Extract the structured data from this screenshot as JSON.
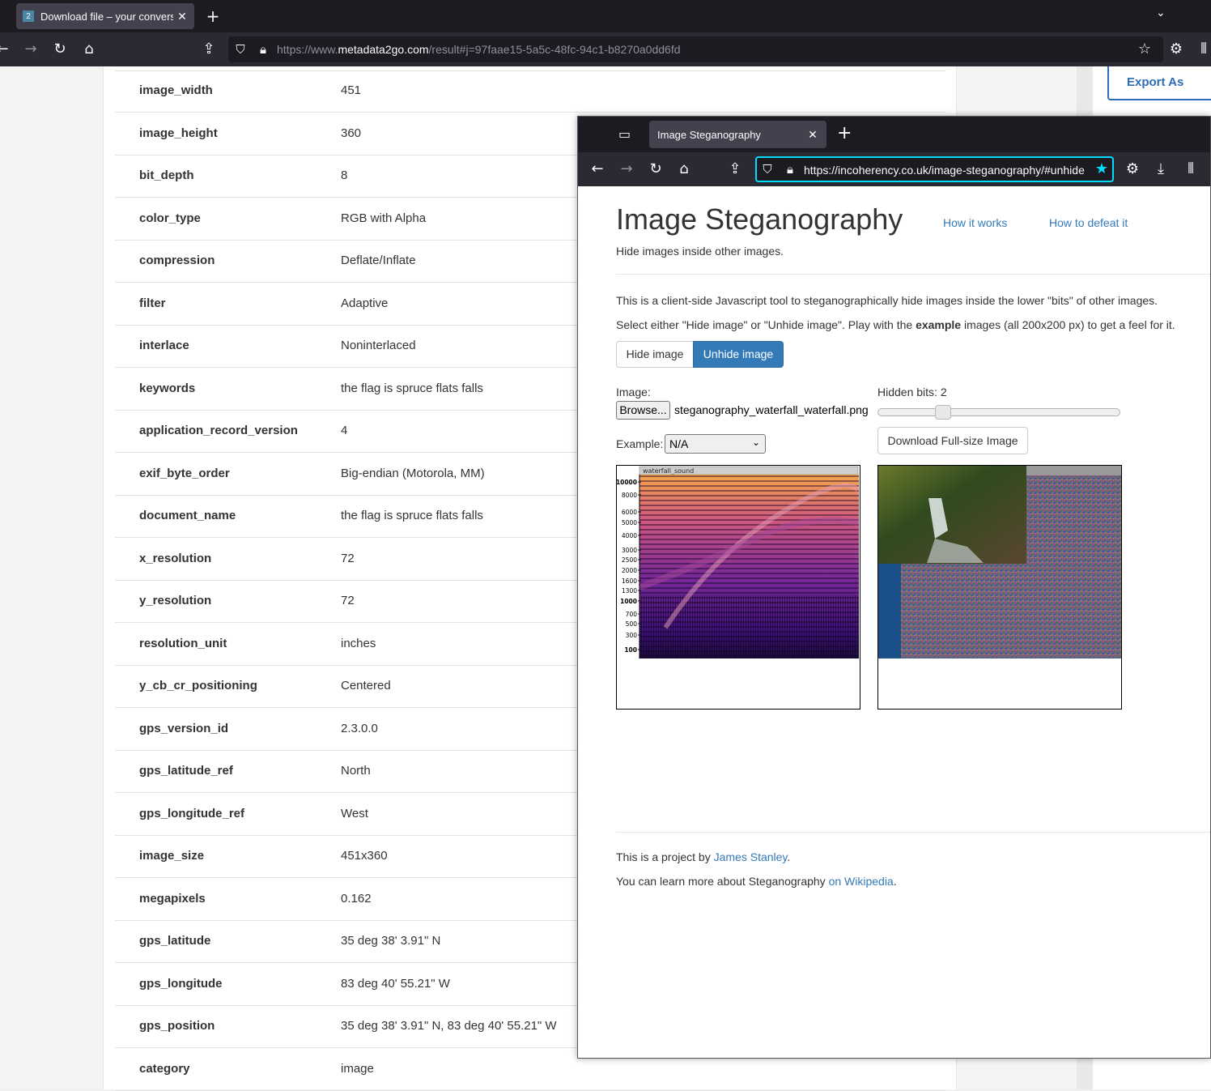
{
  "back_browser": {
    "tab_title": "Download file – your conversion",
    "tab_favicon_text": "2",
    "url_prefix": "https://www.",
    "url_domain": "metadata2go.com",
    "url_rest": "/result#j=97faae15-5a5c-48fc-94c1-b8270a0dd6fd"
  },
  "back_page": {
    "export_label": "Export As",
    "rows": [
      {
        "key": "image_width",
        "value": "451"
      },
      {
        "key": "image_height",
        "value": "360"
      },
      {
        "key": "bit_depth",
        "value": "8"
      },
      {
        "key": "color_type",
        "value": "RGB with Alpha"
      },
      {
        "key": "compression",
        "value": "Deflate/Inflate"
      },
      {
        "key": "filter",
        "value": "Adaptive"
      },
      {
        "key": "interlace",
        "value": "Noninterlaced"
      },
      {
        "key": "keywords",
        "value": "the flag is spruce flats falls"
      },
      {
        "key": "application_record_version",
        "value": "4"
      },
      {
        "key": "exif_byte_order",
        "value": "Big-endian (Motorola, MM)"
      },
      {
        "key": "document_name",
        "value": "the flag is spruce flats falls"
      },
      {
        "key": "x_resolution",
        "value": "72"
      },
      {
        "key": "y_resolution",
        "value": "72"
      },
      {
        "key": "resolution_unit",
        "value": "inches"
      },
      {
        "key": "y_cb_cr_positioning",
        "value": "Centered"
      },
      {
        "key": "gps_version_id",
        "value": "2.3.0.0"
      },
      {
        "key": "gps_latitude_ref",
        "value": "North"
      },
      {
        "key": "gps_longitude_ref",
        "value": "West"
      },
      {
        "key": "image_size",
        "value": "451x360"
      },
      {
        "key": "megapixels",
        "value": "0.162"
      },
      {
        "key": "gps_latitude",
        "value": "35 deg 38' 3.91\" N"
      },
      {
        "key": "gps_longitude",
        "value": "83 deg 40' 55.21\" W"
      },
      {
        "key": "gps_position",
        "value": "35 deg 38' 3.91\" N, 83 deg 40' 55.21\" W"
      },
      {
        "key": "category",
        "value": "image"
      }
    ]
  },
  "front_browser": {
    "tab_title": "Image Steganography",
    "url": "https://incoherency.co.uk/image-steganography/#unhide"
  },
  "steg_page": {
    "title": "Image Steganography",
    "nav_how_it_works": "How it works",
    "nav_how_to_defeat": "How to defeat it",
    "subtitle": "Hide images inside other images.",
    "intro_1": "This is a client-side Javascript tool to steganographically hide images inside the lower \"bits\" of other images.",
    "intro_2_a": "Select either \"Hide image\" or \"Unhide image\". Play with the ",
    "intro_2_b": "example",
    "intro_2_c": " images (all 200x200 px) to get a feel for it.",
    "hide_button": "Hide image",
    "unhide_button": "Unhide image",
    "image_label": "Image:",
    "browse_label": "Browse...",
    "file_name": "steganography_waterfall_waterfall.png",
    "example_label": "Example:",
    "example_selected": "N/A",
    "hidden_bits_label": "Hidden bits: 2",
    "hidden_bits_value": 2,
    "hidden_bits_max": 8,
    "download_button": "Download Full-size Image",
    "spectrogram_title": "waterfall_sound",
    "spectrogram_ticks": [
      "10000",
      "8000",
      "6000",
      "5000",
      "4000",
      "3000",
      "2500",
      "2000",
      "1600",
      "1300",
      "1000",
      "700",
      "500",
      "300",
      "100"
    ],
    "footer_1_a": "This is a project by ",
    "footer_1_link": "James Stanley",
    "footer_1_b": ".",
    "footer_2_a": "You can learn more about Steganography ",
    "footer_2_link": "on Wikipedia",
    "footer_2_b": "."
  },
  "colors": {
    "link": "#337ab7",
    "button_active": "#337ab7",
    "focus_ring": "#00ddff",
    "browser_dark": "#1c1b22",
    "browser_toolbar": "#2b2a33"
  }
}
